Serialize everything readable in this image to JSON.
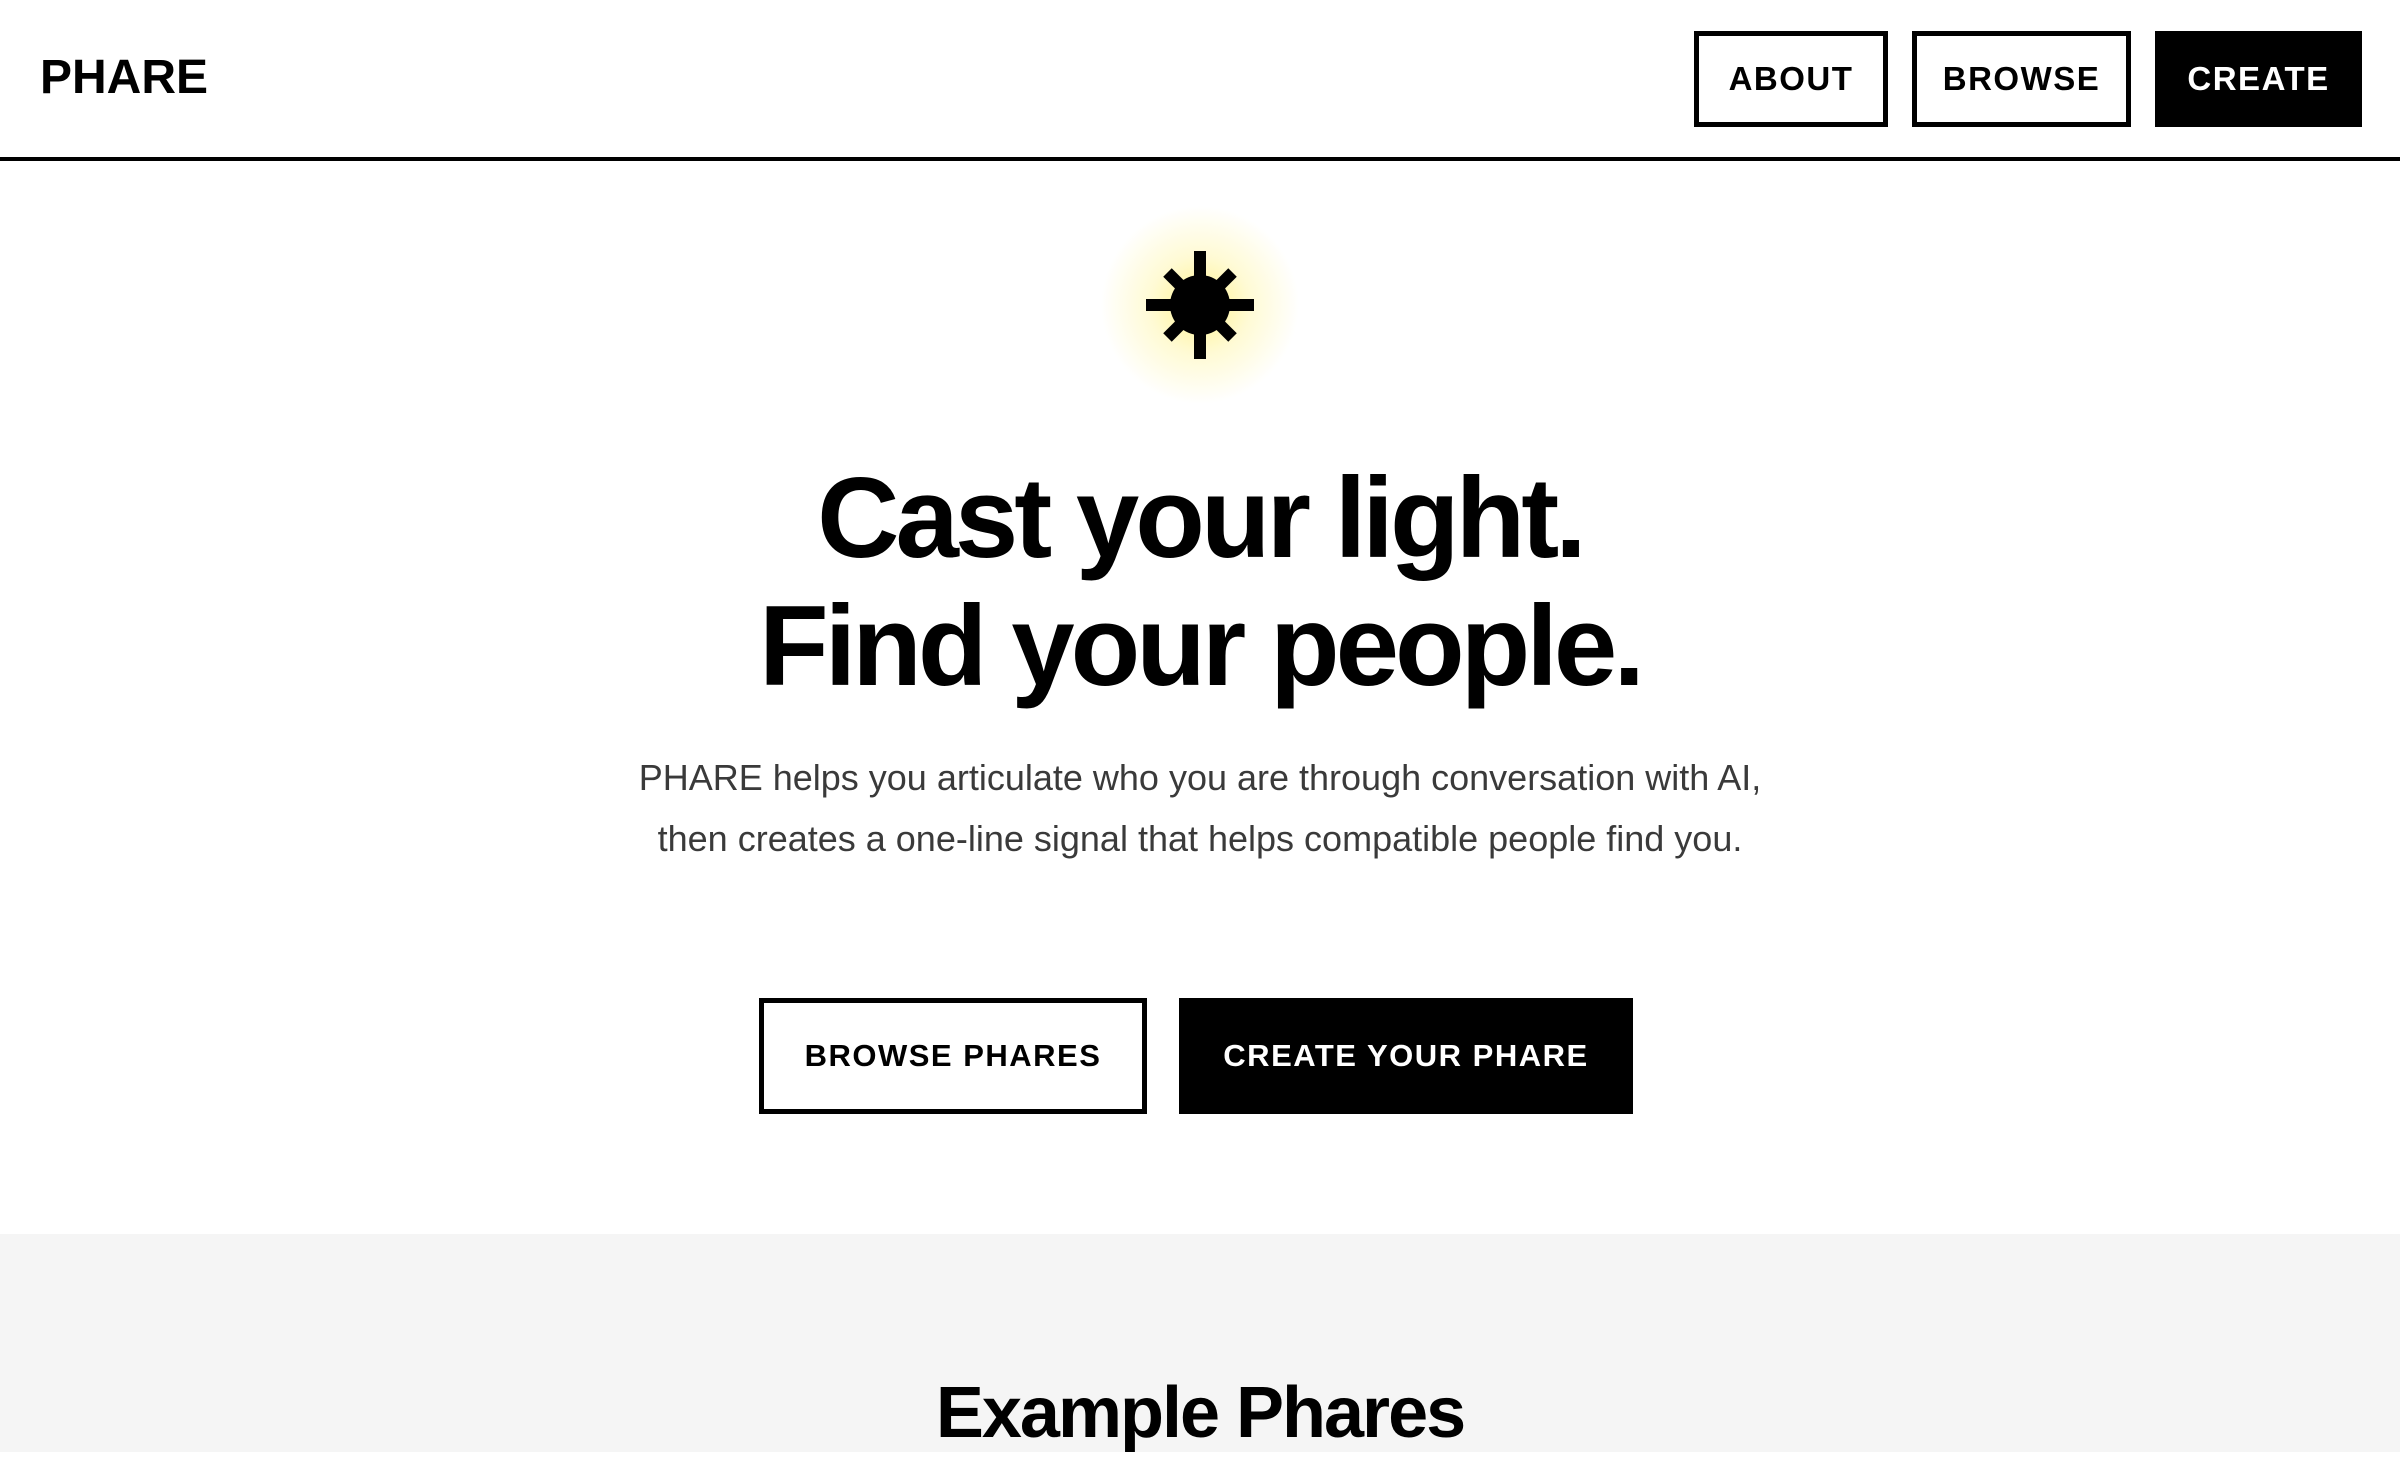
{
  "header": {
    "logo": "PHARE",
    "nav": {
      "about_label": "ABOUT",
      "browse_label": "BROWSE",
      "create_label": "CREATE"
    }
  },
  "hero": {
    "icon": "sun-icon",
    "headline_line1": "Cast your light.",
    "headline_line2": "Find your people.",
    "description": "PHARE helps you articulate who you are through conversation with AI, then creates a one-line signal that helps compatible people find you.",
    "browse_button": "BROWSE PHARES",
    "create_button": "CREATE YOUR PHARE"
  },
  "examples": {
    "title": "Example Phares"
  },
  "colors": {
    "primary": "#000000",
    "background": "#ffffff",
    "section_background": "#f5f5f5",
    "glow": "#fff078",
    "body_text": "#3a3a3a"
  }
}
